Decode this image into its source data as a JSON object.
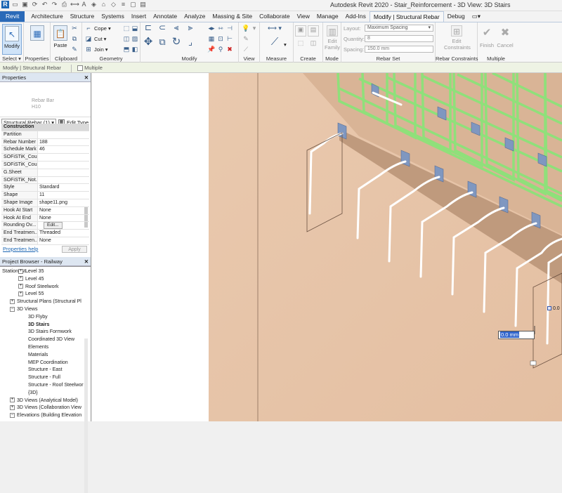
{
  "app": {
    "title": "Autodesk Revit 2020 - Stair_Reinforcement - 3D View: 3D Stairs",
    "logo": "R"
  },
  "tabs": [
    {
      "label": "Revit",
      "type": "file"
    },
    {
      "label": "Architecture"
    },
    {
      "label": "Structure"
    },
    {
      "label": "Systems"
    },
    {
      "label": "Insert"
    },
    {
      "label": "Annotate"
    },
    {
      "label": "Analyze"
    },
    {
      "label": "Massing & Site"
    },
    {
      "label": "Collaborate"
    },
    {
      "label": "View"
    },
    {
      "label": "Manage"
    },
    {
      "label": "Add-Ins"
    },
    {
      "label": "Modify | Structural Rebar",
      "type": "active"
    },
    {
      "label": "Debug"
    }
  ],
  "ribbon": {
    "select": {
      "modify_label": "Modify",
      "panel_label": "Select"
    },
    "properties": {
      "label": "Properties"
    },
    "clipboard": {
      "paste_label": "Paste",
      "panel_label": "Clipboard"
    },
    "geometry": {
      "cope": "Cope",
      "cut": "Cut",
      "join": "Join",
      "panel_label": "Geometry"
    },
    "modify": {
      "panel_label": "Modify"
    },
    "view": {
      "panel_label": "View"
    },
    "measure": {
      "panel_label": "Measure"
    },
    "create": {
      "panel_label": "Create"
    },
    "mode": {
      "edit_family_line1": "Edit",
      "edit_family_line2": "Family",
      "panel_label": "Mode"
    },
    "rebar_set": {
      "layout_label": "Layout:",
      "layout_value": "Maximum Spacing",
      "quantity_label": "Quantity:",
      "quantity_value": "8",
      "spacing_label": "Spacing:",
      "spacing_value": "150.0 mm",
      "panel_label": "Rebar Set"
    },
    "rebar_constraints": {
      "edit_line1": "Edit",
      "edit_line2": "Constraints",
      "panel_label": "Rebar Constraints"
    },
    "multiple": {
      "finish": "Finish",
      "cancel": "Cancel",
      "panel_label": "Multiple"
    }
  },
  "options_bar": {
    "context": "Modify | Structural Rebar",
    "multiple_label": "Multiple"
  },
  "properties_panel": {
    "title": "Properties",
    "type_name_line1": "Rebar Bar",
    "type_name_line2": "H10",
    "selector_value": "Structural Rebar (1)",
    "edit_type": "Edit Type",
    "rows": [
      {
        "key": "Construction",
        "group": true
      },
      {
        "key": "Partition",
        "value": ""
      },
      {
        "key": "Rebar Number",
        "value": "188"
      },
      {
        "key": "Schedule Mark",
        "value": "46"
      },
      {
        "key": "SOFiSTiK_Cou...",
        "value": ""
      },
      {
        "key": "SOFiSTiK_Cou...",
        "value": ""
      },
      {
        "key": "G.Sheet",
        "value": ""
      },
      {
        "key": "SOFiSTiK_Not...",
        "value": ""
      },
      {
        "key": "Style",
        "value": "Standard"
      },
      {
        "key": "Shape",
        "value": "11"
      },
      {
        "key": "Shape Image",
        "value": "shape11.png"
      },
      {
        "key": "Hook At Start",
        "value": "None"
      },
      {
        "key": "Hook At End",
        "value": "None"
      },
      {
        "key": "Rounding Ov...",
        "value": "Edit..."
      },
      {
        "key": "End Treatmen...",
        "value": "Threaded"
      },
      {
        "key": "End Treatmen...",
        "value": "None"
      }
    ],
    "help_link": "Properties help",
    "apply": "Apply"
  },
  "project_browser": {
    "title": "Project Browser - Railway Station_st...",
    "items": [
      {
        "label": "Level 35",
        "level": 2,
        "toggle": "+"
      },
      {
        "label": "Level 45",
        "level": 2,
        "toggle": "+"
      },
      {
        "label": "Roof Steelwork",
        "level": 2,
        "toggle": "+"
      },
      {
        "label": "Level 55",
        "level": 2,
        "toggle": "+"
      },
      {
        "label": "Structural Plans (Structural Pl",
        "level": 1,
        "toggle": "+"
      },
      {
        "label": "3D Views",
        "level": 1,
        "toggle": "-"
      },
      {
        "label": "3D Flyby",
        "level": 2
      },
      {
        "label": "3D Stairs",
        "level": 2,
        "bold": true
      },
      {
        "label": "3D Stairs Formwork",
        "level": 2
      },
      {
        "label": "Coordinated 3D View",
        "level": 2
      },
      {
        "label": "Elements",
        "level": 2
      },
      {
        "label": "Materials",
        "level": 2
      },
      {
        "label": "MEP Coordination",
        "level": 2
      },
      {
        "label": "Structure - East",
        "level": 2
      },
      {
        "label": "Structure - Full",
        "level": 2
      },
      {
        "label": "Structure - Roof Steelwor",
        "level": 2
      },
      {
        "label": "{3D}",
        "level": 2
      },
      {
        "label": "3D Views (Analytical Model)",
        "level": 1,
        "toggle": "+"
      },
      {
        "label": "3D Views (Collaboration View",
        "level": 1,
        "toggle": "+"
      },
      {
        "label": "Elevations (Building Elevation",
        "level": 1,
        "toggle": "-"
      }
    ]
  },
  "viewport": {
    "dimension_value": "0.0 mm",
    "dim_label_right": "0.0",
    "colors": {
      "concrete": "#e6c4aa",
      "concrete_dark": "#c9a487",
      "rebar_green": "#8fe07a",
      "plate": "#7f97c0"
    }
  }
}
